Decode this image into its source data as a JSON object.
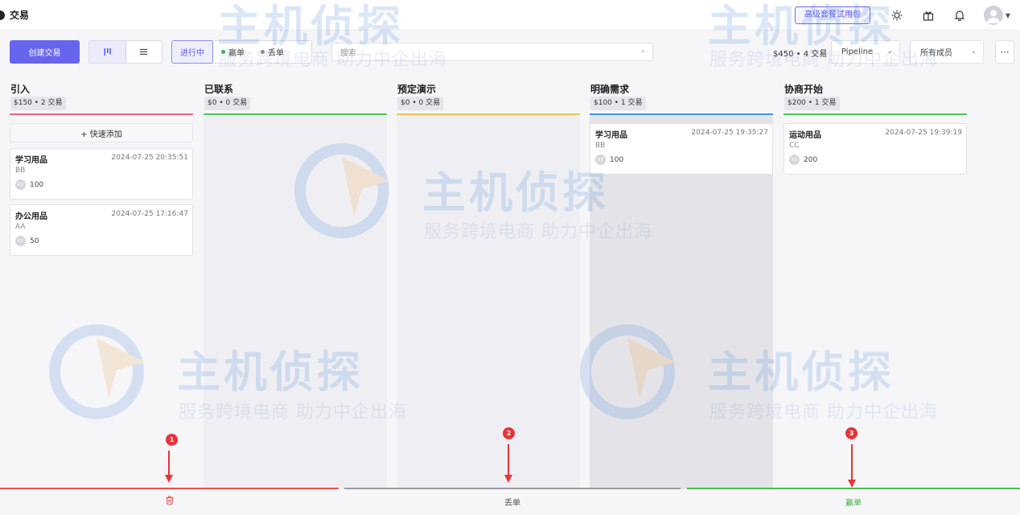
{
  "header": {
    "title": "交易",
    "trial_button": "高级套餐试用包"
  },
  "toolbar": {
    "create_button": "创建交易",
    "status_tabs": [
      {
        "label": "进行中",
        "dot_color": ""
      },
      {
        "label": "赢单",
        "dot_color": "#35b24a"
      },
      {
        "label": "丢单",
        "dot_color": "#888888"
      }
    ],
    "search_placeholder": "搜索",
    "summary": "$450 • 4 交易",
    "pipeline_select": "Pipeline",
    "member_select": "所有成员",
    "more_label": "···"
  },
  "columns": [
    {
      "title": "引入",
      "stat": "$150 • 2 交易",
      "color": "#f0627a",
      "quick_add": "+ 快速添加",
      "cards": [
        {
          "title": "学习用品",
          "date": "2024-07-25 20:35:51",
          "org": "BB",
          "owner_initials": "XX",
          "value": "100"
        },
        {
          "title": "办公用品",
          "date": "2024-07-25 17:16:47",
          "org": "AA",
          "owner_initials": "XX",
          "value": "50"
        }
      ]
    },
    {
      "title": "已联系",
      "stat": "$0 • 0 交易",
      "color": "#4cc25e",
      "quick_add": "",
      "cards": []
    },
    {
      "title": "预定演示",
      "stat": "$0 • 0 交易",
      "color": "#f4c252",
      "quick_add": "",
      "cards": []
    },
    {
      "title": "明确需求",
      "stat": "$100 • 1 交易",
      "color": "#3f97e8",
      "quick_add": "",
      "cards": [
        {
          "title": "学习用品",
          "date": "2024-07-25 19:35:27",
          "org": "BB",
          "owner_initials": "XX",
          "value": "100"
        }
      ]
    },
    {
      "title": "协商开始",
      "stat": "$200 • 1 交易",
      "color": "#4cc25e",
      "quick_add": "",
      "cards": [
        {
          "title": "运动用品",
          "date": "2024-07-25 19:39:19",
          "org": "CC",
          "owner_initials": "XX",
          "value": "200"
        }
      ]
    }
  ],
  "drop_zones": [
    {
      "label": "",
      "icon": "trash-icon",
      "color": "#e85050",
      "marker": "1"
    },
    {
      "label": "丢单",
      "icon": "",
      "color": "#9a9aa3",
      "marker": "2"
    },
    {
      "label": "赢单",
      "icon": "",
      "color": "#4cbf4c",
      "marker": "3"
    }
  ],
  "watermark": {
    "main": "主机侦探",
    "sub": "服务跨境电商 助力中企出海"
  }
}
